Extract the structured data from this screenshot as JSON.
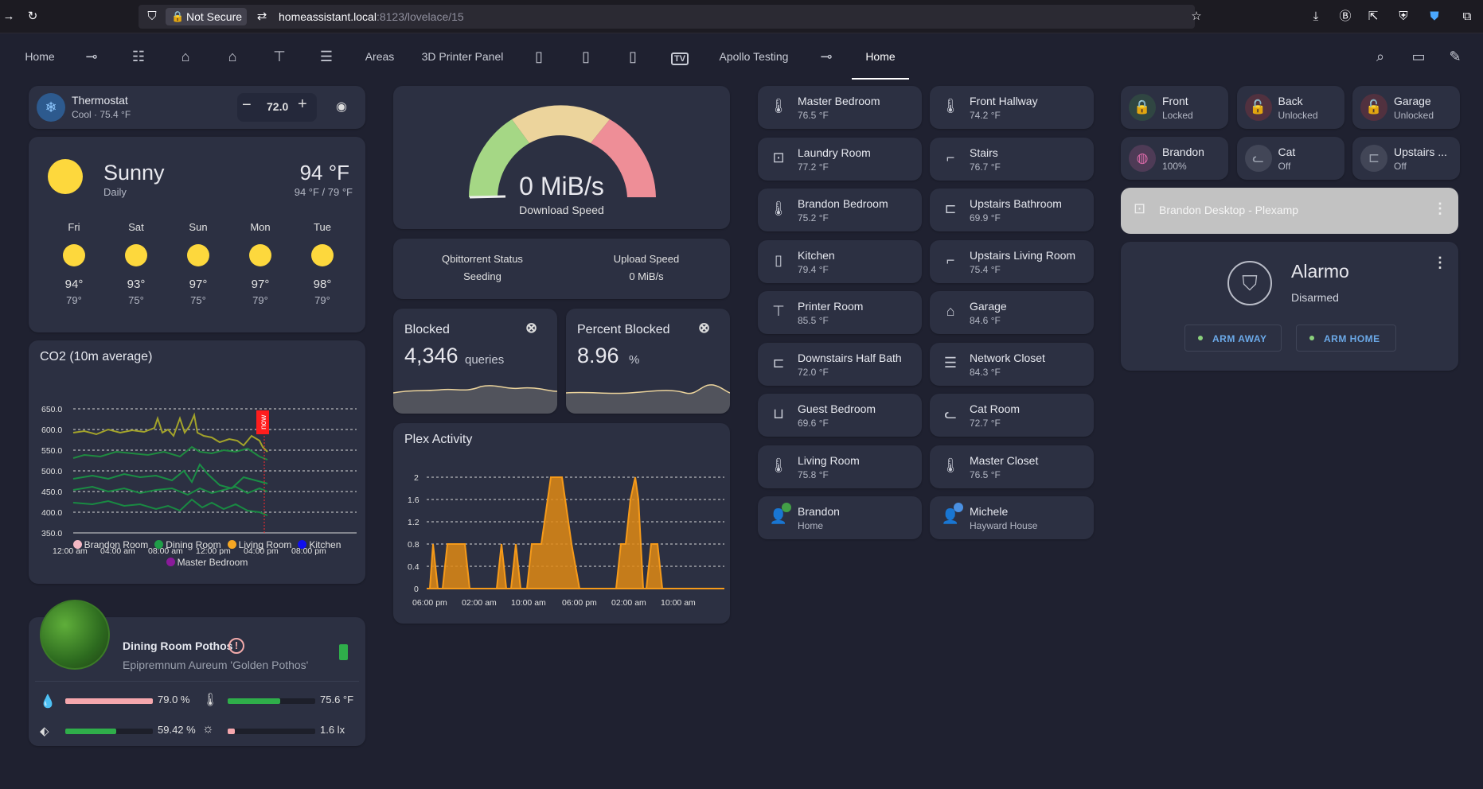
{
  "browser": {
    "security": "Not Secure",
    "url_host": "homeassistant.local",
    "url_rest": ":8123/lovelace/15"
  },
  "tabs": {
    "home": "Home",
    "areas": "Areas",
    "printer_panel": "3D Printer Panel",
    "tv": "TV",
    "apollo": "Apollo Testing",
    "home2": "Home"
  },
  "thermostat": {
    "name": "Thermostat",
    "state": "Cool · 75.4 °F",
    "target": "72.0"
  },
  "weather": {
    "condition": "Sunny",
    "period": "Daily",
    "temp": "94 °F",
    "hilo": "94 °F / 79 °F",
    "forecast": [
      {
        "day": "Fri",
        "hi": "94°",
        "lo": "79°"
      },
      {
        "day": "Sat",
        "hi": "93°",
        "lo": "75°"
      },
      {
        "day": "Sun",
        "hi": "97°",
        "lo": "75°"
      },
      {
        "day": "Mon",
        "hi": "97°",
        "lo": "79°"
      },
      {
        "day": "Tue",
        "hi": "98°",
        "lo": "79°"
      }
    ]
  },
  "co2": {
    "title": "CO2 (10m average)",
    "now_label": "now",
    "legend": [
      {
        "name": "Brandon Room",
        "color": "#f4b8c4"
      },
      {
        "name": "Dining Room",
        "color": "#1f9d48"
      },
      {
        "name": "Living Room",
        "color": "#f5a623"
      },
      {
        "name": "Kitchen",
        "color": "#1010ee"
      },
      {
        "name": "Master Bedroom",
        "color": "#8a1a9a"
      }
    ]
  },
  "gauge": {
    "value": "0 MiB/s",
    "label": "Download Speed"
  },
  "qbit": {
    "status_label": "Qbittorrent Status",
    "status_value": "Seeding",
    "upload_label": "Upload Speed",
    "upload_value": "0 MiB/s"
  },
  "blocked": {
    "title": "Blocked",
    "value": "4,346",
    "unit": "queries"
  },
  "percent_blocked": {
    "title": "Percent Blocked",
    "value": "8.96",
    "unit": "%"
  },
  "plex": {
    "title": "Plex Activity"
  },
  "plant": {
    "name": "Dining Room Pothos",
    "species": "Epipremnum Aureum 'Golden Pothos'",
    "moisture": "79.0 %",
    "temperature": "75.6 °F",
    "conductivity": "59.42 %",
    "illuminance": "1.6 lx"
  },
  "rooms": [
    {
      "name": "Master Bedroom",
      "value": "76.5 °F",
      "icon": "thermometer-icon",
      "glyph": "🌡"
    },
    {
      "name": "Front Hallway",
      "value": "74.2 °F",
      "icon": "thermometer-icon",
      "glyph": "🌡"
    },
    {
      "name": "Laundry Room",
      "value": "77.2 °F",
      "icon": "washing-machine-icon",
      "glyph": "⊡"
    },
    {
      "name": "Stairs",
      "value": "76.7 °F",
      "icon": "stairs-icon",
      "glyph": "⌐"
    },
    {
      "name": "Brandon Bedroom",
      "value": "75.2 °F",
      "icon": "thermometer-icon",
      "glyph": "🌡"
    },
    {
      "name": "Upstairs Bathroom",
      "value": "69.9 °F",
      "icon": "toilet-icon",
      "glyph": "⊏"
    },
    {
      "name": "Kitchen",
      "value": "79.4 °F",
      "icon": "fridge-icon",
      "glyph": "▯"
    },
    {
      "name": "Upstairs Living Room",
      "value": "75.4 °F",
      "icon": "stairs-icon",
      "glyph": "⌐"
    },
    {
      "name": "Printer Room",
      "value": "85.5 °F",
      "icon": "printer-3d-icon",
      "glyph": "⊤"
    },
    {
      "name": "Garage",
      "value": "84.6 °F",
      "icon": "garage-icon",
      "glyph": "⌂"
    },
    {
      "name": "Downstairs Half Bath",
      "value": "72.0 °F",
      "icon": "toilet-icon",
      "glyph": "⊏"
    },
    {
      "name": "Network Closet",
      "value": "84.3 °F",
      "icon": "server-icon",
      "glyph": "☰"
    },
    {
      "name": "Guest Bedroom",
      "value": "69.6 °F",
      "icon": "bed-icon",
      "glyph": "⊔"
    },
    {
      "name": "Cat Room",
      "value": "72.7 °F",
      "icon": "cat-icon",
      "glyph": "ᓚ"
    },
    {
      "name": "Living Room",
      "value": "75.8 °F",
      "icon": "thermometer-icon",
      "glyph": "🌡"
    },
    {
      "name": "Master Closet",
      "value": "76.5 °F",
      "icon": "thermometer-icon",
      "glyph": "🌡"
    },
    {
      "name": "Brandon",
      "value": "Home",
      "icon": "person-icon",
      "glyph": "👤"
    },
    {
      "name": "Michele",
      "value": "Hayward House",
      "icon": "person-icon",
      "glyph": "👤"
    }
  ],
  "locks": [
    {
      "name": "Front",
      "state": "Locked",
      "color": "#43a047"
    },
    {
      "name": "Back",
      "state": "Unlocked",
      "color": "#e53935"
    },
    {
      "name": "Garage",
      "state": "Unlocked",
      "color": "#e53935"
    },
    {
      "name": "Brandon",
      "state": "100%",
      "color": "#d96aa8"
    },
    {
      "name": "Cat",
      "state": "Off",
      "color": "#9aa0ad"
    },
    {
      "name": "Upstairs ...",
      "state": "Off",
      "color": "#9aa0ad"
    }
  ],
  "media": {
    "title": "Brandon Desktop - Plexamp"
  },
  "alarm": {
    "title": "Alarmo",
    "state": "Disarmed",
    "arm_away": "ARM AWAY",
    "arm_home": "ARM HOME"
  }
}
